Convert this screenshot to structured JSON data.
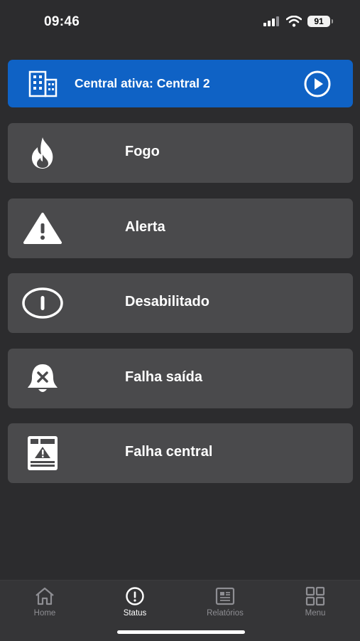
{
  "status_bar": {
    "time": "09:46",
    "battery": "91"
  },
  "central": {
    "label": "Central ativa: Central 2"
  },
  "items": [
    {
      "label": "Fogo",
      "icon": "fire-icon"
    },
    {
      "label": "Alerta",
      "icon": "warning-icon"
    },
    {
      "label": "Desabilitado",
      "icon": "disabled-circle-icon"
    },
    {
      "label": "Falha saída",
      "icon": "bell-x-icon"
    },
    {
      "label": "Falha central",
      "icon": "panel-fault-icon"
    }
  ],
  "tabs": [
    {
      "label": "Home",
      "icon": "home-icon"
    },
    {
      "label": "Status",
      "icon": "status-icon",
      "active": true
    },
    {
      "label": "Relatórios",
      "icon": "reports-icon"
    },
    {
      "label": "Menu",
      "icon": "grid-icon"
    }
  ],
  "colors": {
    "accent": "#0f62c5",
    "card": "#4a4a4c",
    "background": "#2c2c2e"
  }
}
